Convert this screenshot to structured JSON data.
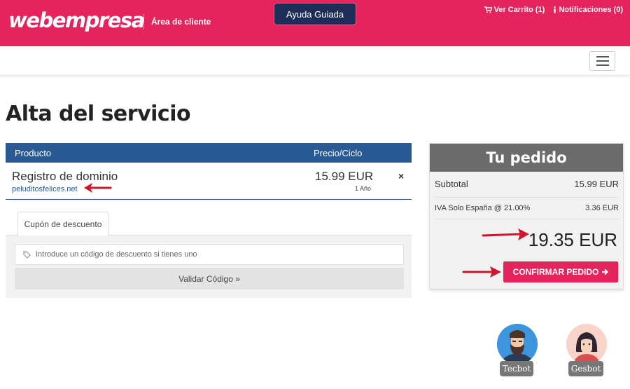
{
  "header": {
    "logo": "webempresa",
    "area_label": "Área de cliente",
    "help_button": "Ayuda Guiada",
    "cart_link": "Ver Carrito (1)",
    "notifications_link": "Notificaciones (0)"
  },
  "page": {
    "title": "Alta del servicio"
  },
  "table": {
    "headers": {
      "product": "Producto",
      "price": "Precio/Ciclo"
    },
    "rows": [
      {
        "name": "Registro de dominio",
        "domain": "peluditosfelices.net",
        "price": "15.99 EUR",
        "cycle": "1 Año",
        "remove": "×"
      }
    ]
  },
  "coupon": {
    "tab_label": "Cupón de descuento",
    "input_placeholder": "Introduce un código de descuento si tienes uno",
    "validate_button": "Validar Código »"
  },
  "order": {
    "title": "Tu pedido",
    "subtotal_label": "Subtotal",
    "subtotal_value": "15.99 EUR",
    "tax_label": "IVA Solo España @ 21.00%",
    "tax_value": "3.36 EUR",
    "total": "19.35 EUR",
    "confirm_button": "CONFIRMAR PEDIDO"
  },
  "bots": [
    {
      "name": "Tecbot"
    },
    {
      "name": "Gesbot"
    }
  ],
  "colors": {
    "brand_pink": "#e5245d",
    "navy": "#1e2d57",
    "table_blue": "#2a5a94",
    "annotation_red": "#d0142c"
  }
}
